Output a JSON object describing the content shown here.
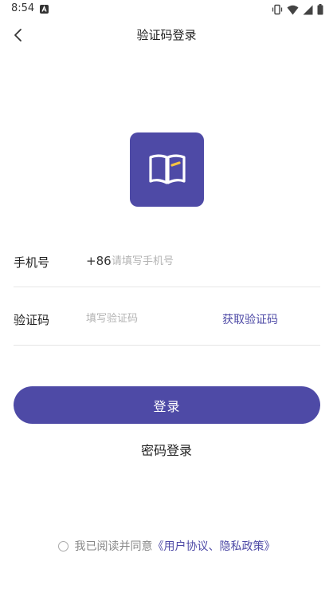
{
  "status_bar": {
    "time": "8:54",
    "left_icon": "a-square-icon",
    "right_icons": [
      "vibrate-icon",
      "wifi-icon",
      "signal-icon",
      "battery-icon"
    ]
  },
  "nav": {
    "back_icon": "chevron-left-icon",
    "title": "验证码登录"
  },
  "logo": {
    "icon": "open-book-icon",
    "brand_color": "#4e4aa6",
    "accent_color": "#f5c242"
  },
  "form": {
    "phone": {
      "label": "手机号",
      "country_code": "+86",
      "value": "",
      "placeholder": "请填写手机号"
    },
    "code": {
      "label": "验证码",
      "value": "",
      "placeholder": "填写验证码",
      "get_code_label": "获取验证码"
    }
  },
  "actions": {
    "login_label": "登录",
    "password_login_label": "密码登录"
  },
  "agreement": {
    "checked": false,
    "prefix": "我已阅读并同意",
    "links": "《用户协议、隐私政策》"
  },
  "colors": {
    "primary": "#4e4aa6",
    "placeholder": "#b3b3b3",
    "divider": "#e6e6e6"
  }
}
